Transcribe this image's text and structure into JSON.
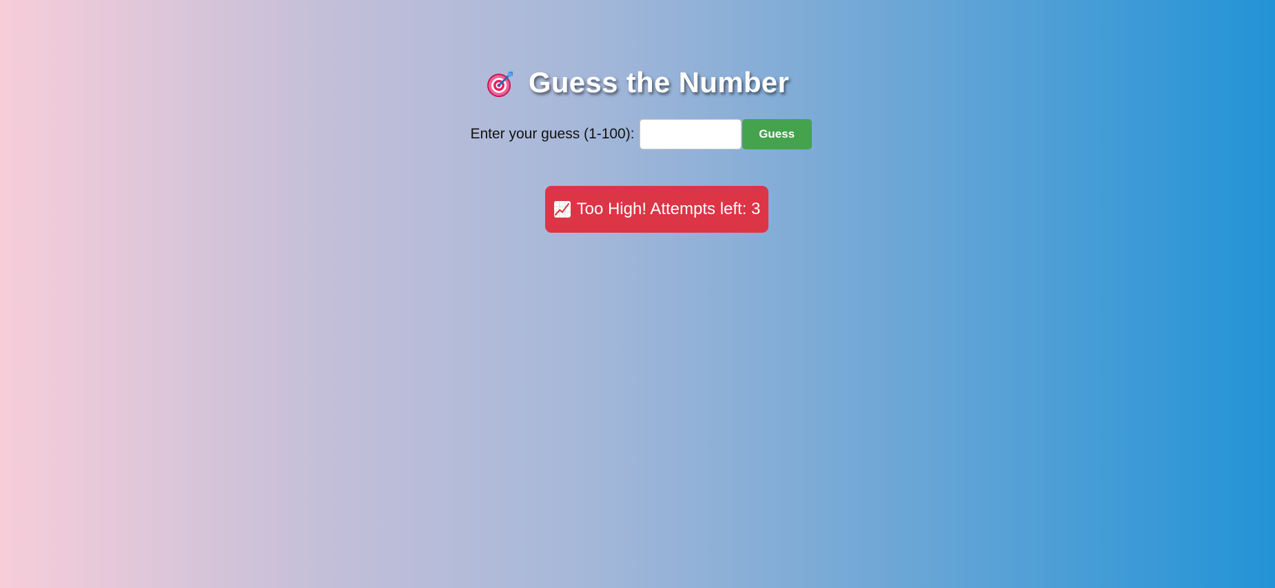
{
  "header": {
    "icon": "direct-hit-target-icon",
    "title": "Guess the Number"
  },
  "form": {
    "label": "Enter your guess (1-100):",
    "input_value": "",
    "input_placeholder": "",
    "button_label": "Guess"
  },
  "feedback": {
    "icon": "chart-increasing-icon",
    "message": "Too High! Attempts left: 3",
    "color": "#dc3546"
  },
  "colors": {
    "background_start": "#f7cdd9",
    "background_end": "#2293d6",
    "button": "#44a34c"
  }
}
